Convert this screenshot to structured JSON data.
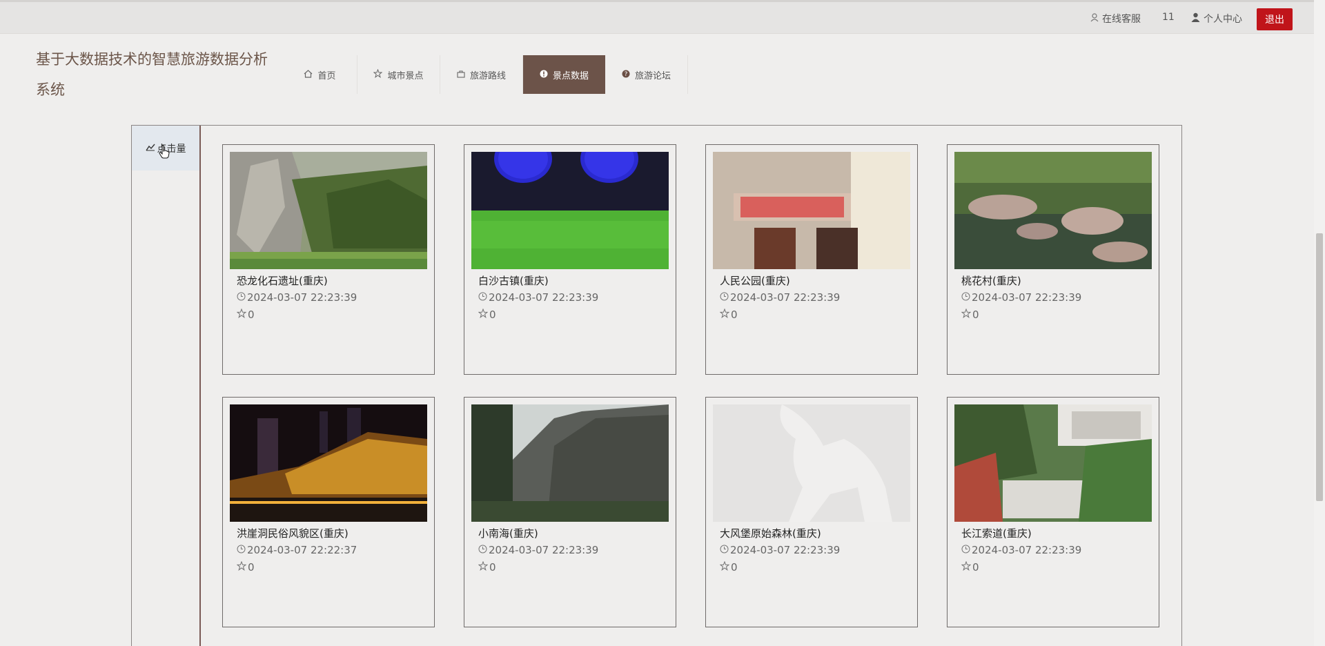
{
  "topbar": {
    "service_label": "在线客服",
    "count": "11",
    "user_label": "个人中心",
    "logout_label": "退出"
  },
  "site_title": "基于大数据技术的智慧旅游数据分析系统",
  "nav": [
    {
      "label": "首页",
      "icon": "home-icon"
    },
    {
      "label": "城市景点",
      "icon": "star-icon"
    },
    {
      "label": "旅游路线",
      "icon": "bag-icon"
    },
    {
      "label": "景点数据",
      "icon": "alert-icon",
      "active": true
    },
    {
      "label": "旅游论坛",
      "icon": "question-icon"
    }
  ],
  "sidebar": {
    "items": [
      {
        "label": "点击量",
        "icon": "chart-icon"
      }
    ]
  },
  "cards": [
    {
      "name": "恐龙化石遗址(重庆)",
      "time": "2024-03-07 22:23:39",
      "favorites": "0",
      "image": "cliff-river"
    },
    {
      "name": "白沙古镇(重庆)",
      "time": "2024-03-07 22:23:39",
      "favorites": "0",
      "image": "blue-lights-green"
    },
    {
      "name": "人民公园(重庆)",
      "time": "2024-03-07 22:23:39",
      "favorites": "0",
      "image": "red-sign-room"
    },
    {
      "name": "桃花村(重庆)",
      "time": "2024-03-07 22:23:39",
      "favorites": "0",
      "image": "river-rocks"
    },
    {
      "name": "洪崖洞民俗风貌区(重庆)",
      "time": "2024-03-07 22:22:37",
      "favorites": "0",
      "image": "night-buildings"
    },
    {
      "name": "小南海(重庆)",
      "time": "2024-03-07 22:23:39",
      "favorites": "0",
      "image": "canyon"
    },
    {
      "name": "大风堡原始森林(重庆)",
      "time": "2024-03-07 22:23:39",
      "favorites": "0",
      "image": "placeholder-camel"
    },
    {
      "name": "长江索道(重庆)",
      "time": "2024-03-07 22:23:39",
      "favorites": "0",
      "image": "trees-building"
    }
  ],
  "colors": {
    "accent": "#6c5349",
    "logout": "#c0141a",
    "title": "#6b5549"
  }
}
